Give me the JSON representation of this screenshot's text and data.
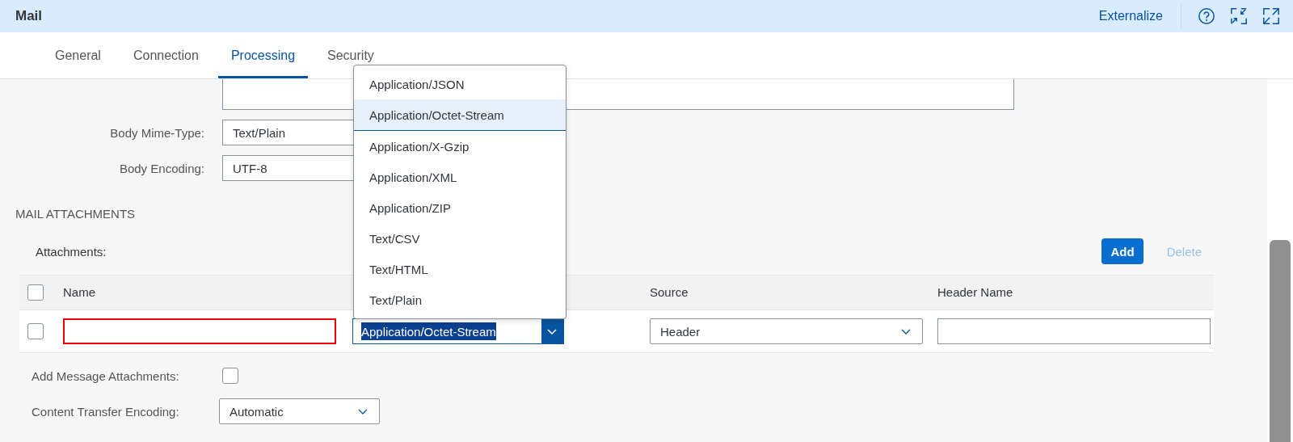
{
  "header": {
    "title": "Mail",
    "link": "Externalize"
  },
  "tabs": [
    {
      "label": "General",
      "selected": false
    },
    {
      "label": "Connection",
      "selected": false
    },
    {
      "label": "Processing",
      "selected": true
    },
    {
      "label": "Security",
      "selected": false
    }
  ],
  "body_fields": [
    {
      "label": "Body Mime-Type:",
      "value": "Text/Plain"
    },
    {
      "label": "Body Encoding:",
      "value": "UTF-8"
    }
  ],
  "section_title": "MAIL ATTACHMENTS",
  "attachments": {
    "label": "Attachments:",
    "buttons": [
      {
        "label": "Add",
        "kind": "primary",
        "disabled": false
      },
      {
        "label": "Delete",
        "kind": "ghost",
        "disabled": true
      }
    ],
    "select_all_checked": false,
    "columns": {
      "name": "Name",
      "source": "Source",
      "header_name": "Header Name"
    },
    "rows": [
      {
        "checked": false,
        "name_error": true,
        "type": "Application/Octet-Stream",
        "type_open": true,
        "source": "Header"
      }
    ]
  },
  "dropdown": {
    "options": [
      {
        "label": "Application/JSON",
        "selected": false
      },
      {
        "label": "Application/Octet-Stream",
        "selected": true
      },
      {
        "label": "Application/X-Gzip",
        "selected": false
      },
      {
        "label": "Application/XML",
        "selected": false
      },
      {
        "label": "Application/ZIP",
        "selected": false
      },
      {
        "label": "Text/CSV",
        "selected": false
      },
      {
        "label": "Text/HTML",
        "selected": false
      },
      {
        "label": "Text/Plain",
        "selected": false
      }
    ]
  },
  "add_message_attachments": {
    "label": "Add Message Attachments:",
    "checked": false
  },
  "content_transfer_encoding": {
    "label": "Content Transfer Encoding:",
    "value": "Automatic"
  }
}
